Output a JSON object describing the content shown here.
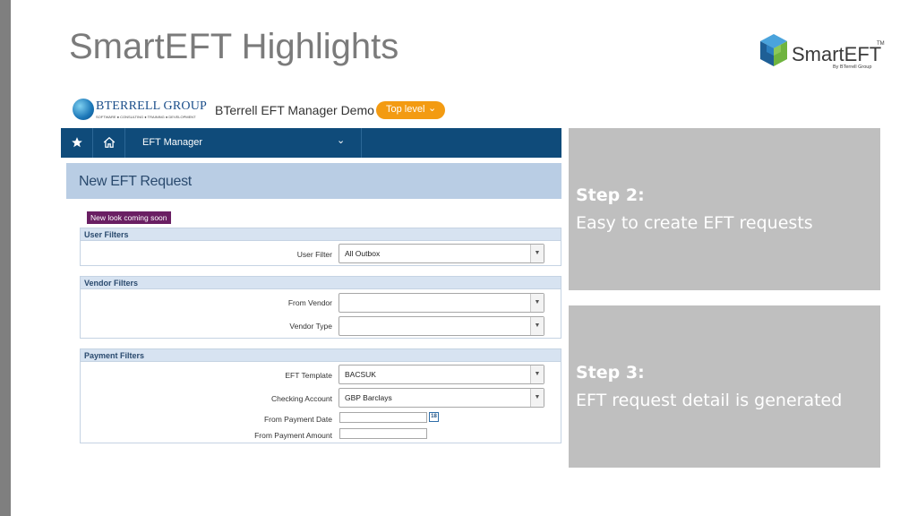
{
  "slide": {
    "title": "SmartEFT Highlights"
  },
  "brand": {
    "name": "SmartEFT",
    "tm": "TM",
    "subtitle": "By BTerrell Group",
    "cube_colors": [
      "#2b7fc0",
      "#6fb43f",
      "#1e5f96"
    ]
  },
  "app": {
    "company": {
      "name": "BTERRELL GROUP",
      "tagline": "SOFTWARE ● CONSULTING ● TRAINING ● DEVELOPMENT"
    },
    "demo_title": "BTerrell EFT Manager Demo",
    "level_button": "Top level",
    "nav": {
      "star_icon": "star-icon",
      "home_icon": "home-icon",
      "menu_label": "EFT Manager"
    },
    "page_title": "New EFT Request",
    "notice": "New look coming soon",
    "user_filters": {
      "heading": "User Filters",
      "user_filter_label": "User Filter",
      "user_filter_value": "All Outbox"
    },
    "vendor_filters": {
      "heading": "Vendor Filters",
      "from_vendor_label": "From Vendor",
      "from_vendor_value": "",
      "vendor_type_label": "Vendor Type",
      "vendor_type_value": ""
    },
    "payment_filters": {
      "heading": "Payment Filters",
      "eft_template_label": "EFT Template",
      "eft_template_value": "BACSUK",
      "checking_account_label": "Checking Account",
      "checking_account_value": "GBP Barclays",
      "from_payment_date_label": "From Payment Date",
      "from_payment_date_value": "",
      "calendar_label": "18",
      "from_payment_amount_label": "From Payment Amount",
      "from_payment_amount_value": ""
    }
  },
  "steps": [
    {
      "title": "Step 2:",
      "description": "Easy to create EFT requests"
    },
    {
      "title": "Step 3:",
      "description": "EFT request detail is generated"
    }
  ],
  "colors": {
    "navbar": "#0f4b7a",
    "accent_orange": "#f39b12",
    "notice_purple": "#6a1f63",
    "step_box": "#bfbfbf"
  }
}
